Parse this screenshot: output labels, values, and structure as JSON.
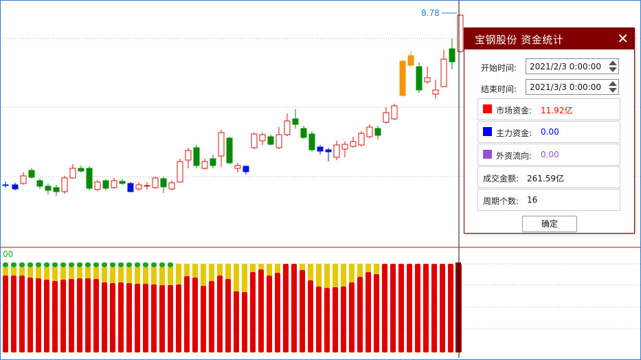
{
  "chart": {
    "price_label": "8.78",
    "sub_label": "00",
    "colors": {
      "up": "#d11",
      "down": "#0a8a0a",
      "blue": "#0014e0",
      "orange": "#f5960a",
      "yellow": "#e6c80a",
      "red": "#e00000",
      "green": "#1aa51a"
    }
  },
  "chart_data": {
    "type": "candlestick",
    "title": "",
    "main_candles": [
      {
        "o": 252,
        "c": 252,
        "h": 252,
        "l": 252,
        "t": "n"
      },
      {
        "o": 252,
        "c": 252,
        "h": 252,
        "l": 252,
        "t": "n"
      },
      {
        "o": 248,
        "c": 244,
        "h": 250,
        "l": 241,
        "t": "n"
      },
      {
        "o": 245,
        "c": 236,
        "h": 248,
        "l": 233,
        "t": "n"
      },
      {
        "o": 238,
        "c": 228,
        "h": 242,
        "l": 225,
        "t": "n"
      },
      {
        "o": 232,
        "c": 236,
        "h": 239,
        "l": 229,
        "t": "n"
      },
      {
        "o": 230,
        "c": 230,
        "h": 234,
        "l": 226,
        "t": "n"
      },
      {
        "o": 235,
        "c": 232,
        "h": 240,
        "l": 228,
        "t": "n"
      },
      {
        "o": 227,
        "c": 227,
        "h": 231,
        "l": 224,
        "t": "n"
      },
      {
        "o": 228,
        "c": 236,
        "h": 240,
        "l": 225,
        "t": "n"
      },
      {
        "o": 237,
        "c": 242,
        "h": 247,
        "l": 234,
        "t": "n"
      },
      {
        "o": 245,
        "c": 250,
        "h": 253,
        "l": 240,
        "t": "n"
      },
      {
        "o": 248,
        "c": 248,
        "h": 251,
        "l": 244,
        "t": "n"
      },
      {
        "o": 245,
        "c": 238,
        "h": 250,
        "l": 233,
        "t": "n"
      },
      {
        "o": 235,
        "c": 226,
        "h": 240,
        "l": 222,
        "t": "n"
      },
      {
        "o": 232,
        "c": 238,
        "h": 242,
        "l": 228,
        "t": "n"
      },
      {
        "o": 236,
        "c": 236,
        "h": 240,
        "l": 232,
        "t": "n"
      },
      {
        "o": 239,
        "c": 239,
        "h": 243,
        "l": 234,
        "t": "n"
      },
      {
        "o": 240,
        "c": 240,
        "h": 246,
        "l": 236,
        "t": "n"
      }
    ]
  },
  "dialog": {
    "title": "宝钢股份  资金统计",
    "close_glyph": "✕",
    "start_label": "开始时间:",
    "start_value": "2021/2/3 0:00:00",
    "end_label": "结束时间:",
    "end_value": "2021/3/3 0:00:00",
    "market_label": "市场资金:",
    "market_value": "11.92亿",
    "market_color": "#ff0000",
    "main_label": "主力资金:",
    "main_value": "0.00",
    "main_color": "#0000ff",
    "foreign_label": "外资流向:",
    "foreign_value": "0.00",
    "foreign_color": "#9b4fd6",
    "turnover_label": "成交金额:",
    "turnover_value": "261.59亿",
    "count_label": "周期个数:",
    "count_value": "16",
    "ok_label": "确定"
  }
}
